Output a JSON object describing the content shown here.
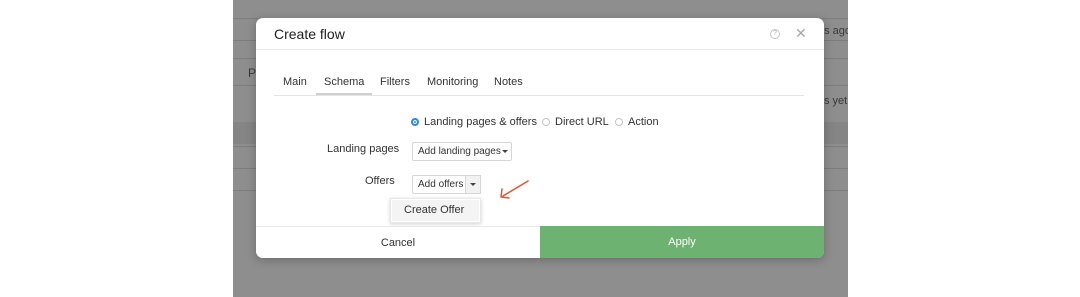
{
  "background": {
    "fragments": [
      "es ago",
      "P",
      "s yet."
    ]
  },
  "modal": {
    "title": "Create flow",
    "help_glyph": "?",
    "close_glyph": "✕"
  },
  "tabs": [
    {
      "label": "Main",
      "active": false
    },
    {
      "label": "Schema",
      "active": true
    },
    {
      "label": "Filters",
      "active": false
    },
    {
      "label": "Monitoring",
      "active": false
    },
    {
      "label": "Notes",
      "active": false
    }
  ],
  "schema": {
    "options": [
      {
        "label": "Landing pages & offers",
        "checked": true
      },
      {
        "label": "Direct URL",
        "checked": false
      },
      {
        "label": "Action",
        "checked": false
      }
    ],
    "landing_pages": {
      "label": "Landing pages",
      "button": "Add landing pages"
    },
    "offers": {
      "label": "Offers",
      "button": "Add offers"
    },
    "dropdown_items": [
      "Create Offer"
    ]
  },
  "footer": {
    "cancel": "Cancel",
    "apply": "Apply"
  },
  "colors": {
    "accent": "#2d89e8",
    "apply": "#6db270",
    "annotation_arrow": "#e8532a",
    "backdrop": "#8e8e8e"
  }
}
